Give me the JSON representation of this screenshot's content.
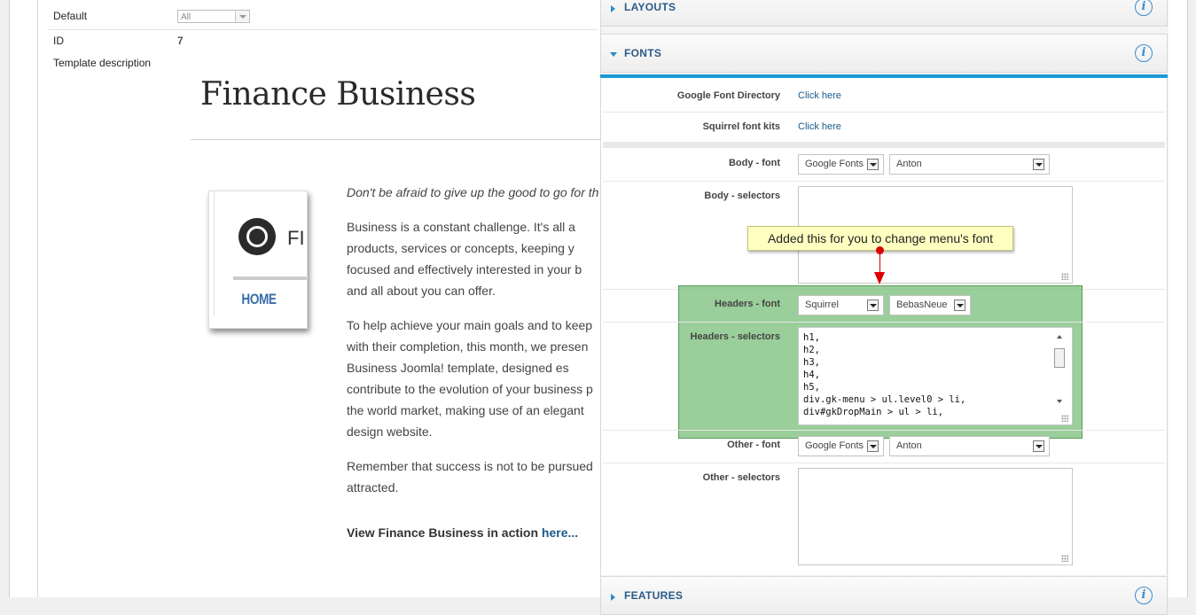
{
  "left": {
    "default_label": "Default",
    "default_value": "All",
    "id_label": "ID",
    "id_value": "7",
    "desc_label": "Template description",
    "desc_title": "Finance Business",
    "logo_text": "FI",
    "home_text": "HOME",
    "intro": "Don't be afraid to give up the good to go for th",
    "p1": [
      "Business is a constant challenge. It's all a",
      "products, services or concepts, keeping y",
      "focused and effectively interested in your b",
      "and all about you can offer."
    ],
    "p2": [
      "To help achieve your main goals and to keep",
      "with their completion, this month, we presen",
      "Business Joomla! template, designed es",
      "contribute to the evolution of your business p",
      "the world market, making use of an elegant",
      "design website."
    ],
    "p3": [
      "Remember that success is not to be pursued",
      "attracted."
    ],
    "action_text": "View Finance Business in action ",
    "action_link": "here..."
  },
  "right": {
    "layouts_title": "LAYOUTS",
    "fonts_title": "FONTS",
    "features_title": "FEATURES",
    "info_glyph": "i",
    "google_dir_label": "Google Font Directory",
    "google_dir_link": "Click here",
    "squirrel_label": "Squirrel font kits",
    "squirrel_link": "Click here",
    "body_font_label": "Body - font",
    "body_font_source": "Google Fonts",
    "body_font_name": "Anton",
    "body_selectors_label": "Body - selectors",
    "headers_font_label": "Headers - font",
    "headers_font_source": "Squirrel",
    "headers_font_name": "BebasNeue",
    "headers_selectors_label": "Headers - selectors",
    "headers_selectors_value": "h1,\nh2,\nh3,\nh4,\nh5,\ndiv.gk-menu > ul.level0 > li,\ndiv#gkDropMain > ul > li,",
    "other_font_label": "Other - font",
    "other_font_source": "Google Fonts",
    "other_font_name": "Anton",
    "other_selectors_label": "Other - selectors"
  },
  "tooltip": "Added this for you to change menu's font",
  "colors": {
    "accent_blue": "#1a9ad6",
    "highlight_green": "#78be78",
    "tooltip_yellow": "#ffffc2",
    "arrow_red": "#dd0000"
  }
}
